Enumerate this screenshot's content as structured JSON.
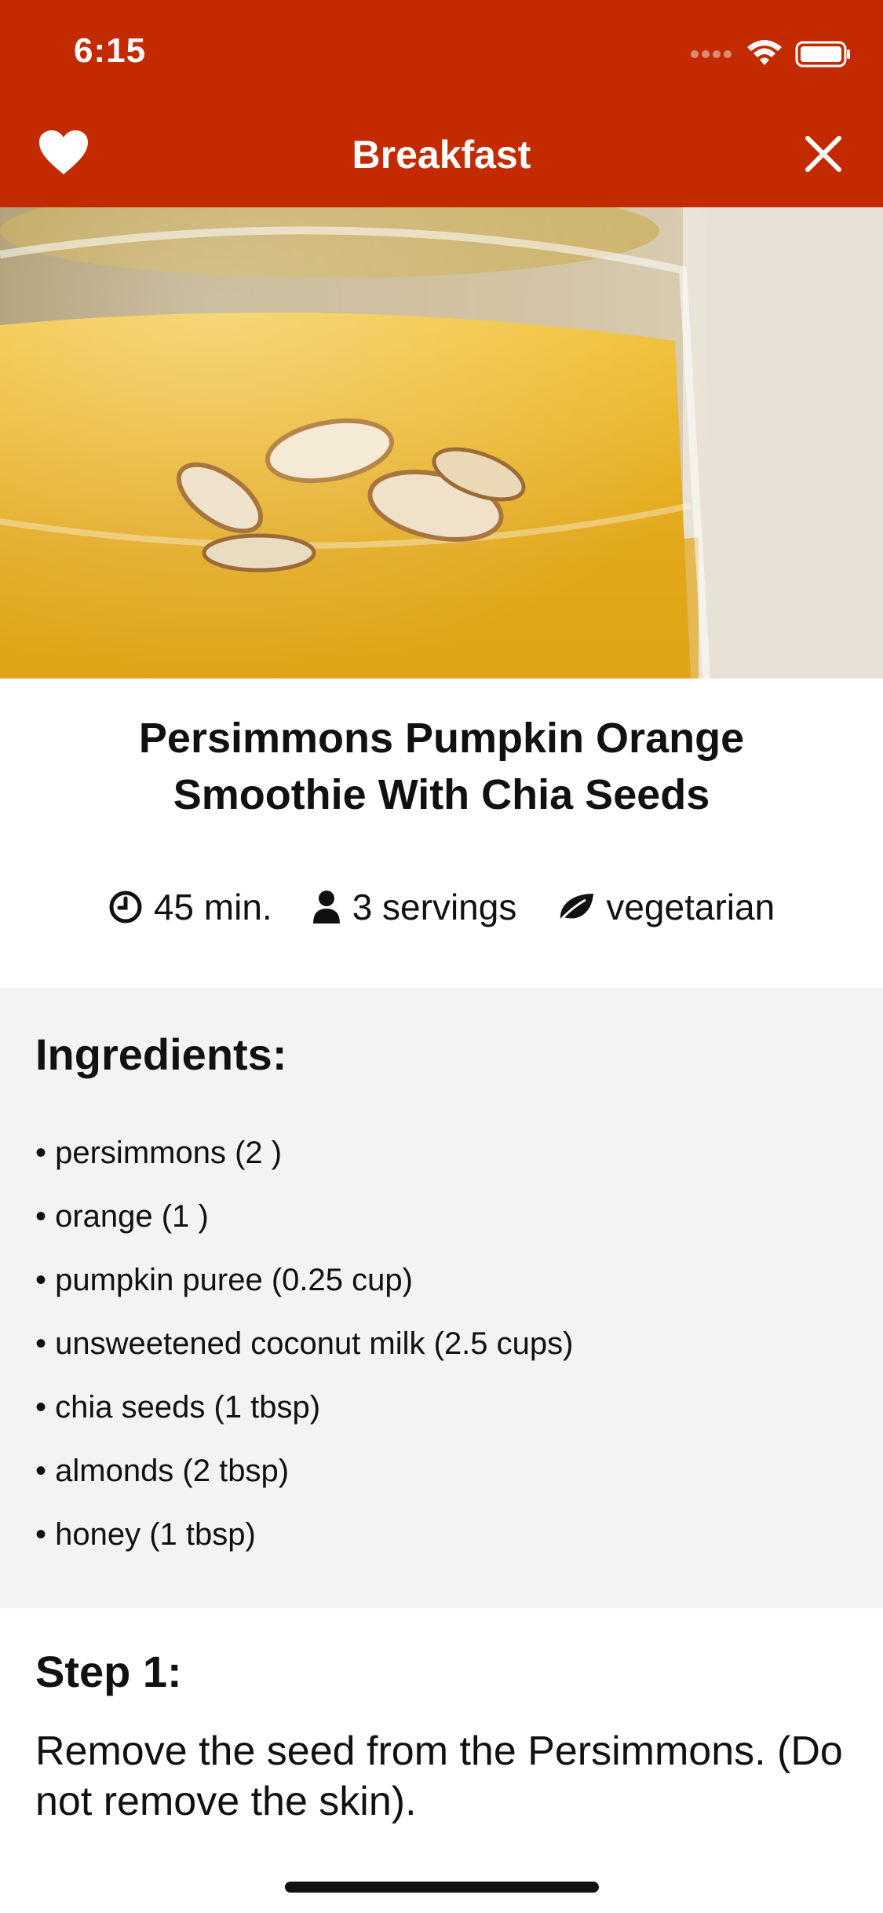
{
  "status_bar": {
    "time": "6:15"
  },
  "nav": {
    "title": "Breakfast",
    "left_icon": "heart-icon",
    "right_icon": "close-icon"
  },
  "recipe": {
    "title": "Persimmons Pumpkin Orange Smoothie With Chia Seeds",
    "meta": {
      "time": "45 min.",
      "servings": "3 servings",
      "diet": "vegetarian"
    }
  },
  "ingredients": {
    "heading": "Ingredients:",
    "items": [
      "• persimmons (2 )",
      "• orange (1 )",
      "• pumpkin puree (0.25 cup)",
      "• unsweetened coconut milk (2.5 cups)",
      "• chia seeds (1 tbsp)",
      "• almonds (2 tbsp)",
      "• honey (1 tbsp)"
    ]
  },
  "step": {
    "heading": "Step 1:",
    "text": "Remove the seed from the Persimmons. (Do not remove the skin)."
  },
  "colors": {
    "accent": "#c42a00",
    "ingredients_bg": "#f3f3f3"
  }
}
